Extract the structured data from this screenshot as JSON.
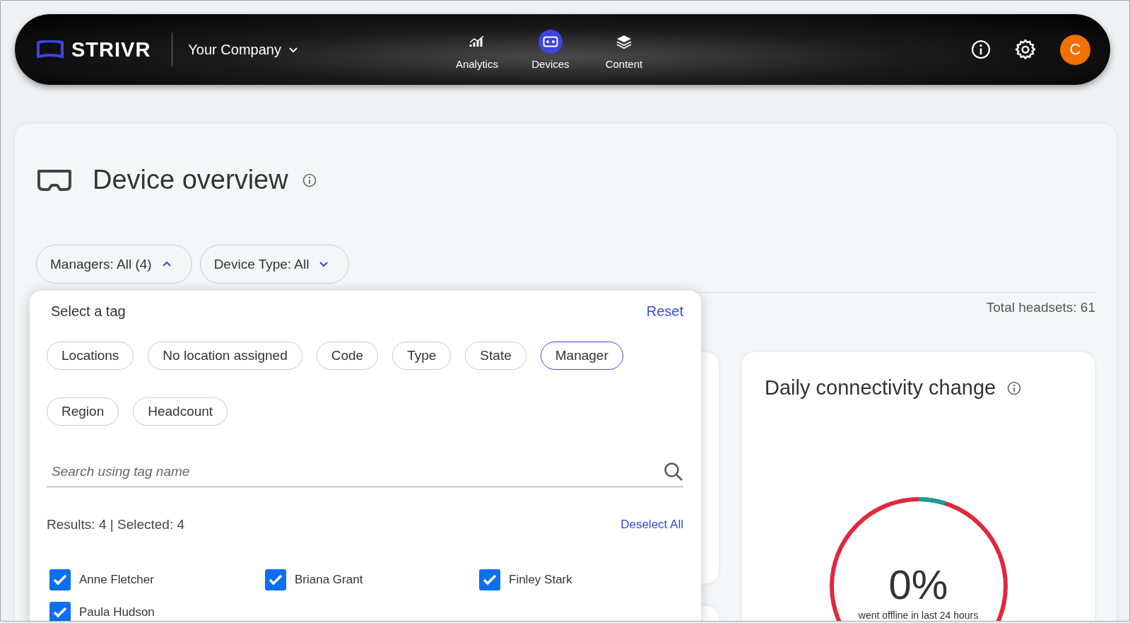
{
  "navbar": {
    "logo": "STRIVR",
    "company": "Your Company",
    "nav_items": [
      {
        "label": "Analytics",
        "kind": "analytics",
        "selected": false
      },
      {
        "label": "Devices",
        "kind": "devices",
        "selected": true
      },
      {
        "label": "Content",
        "kind": "content",
        "selected": false
      }
    ],
    "avatar": "C"
  },
  "page": {
    "title": "Device overview",
    "filters": [
      {
        "label": "Managers: All (4)",
        "expanded": true
      },
      {
        "label": "Device Type: All",
        "expanded": false
      }
    ],
    "total": "Total headsets: 61"
  },
  "tag_popup": {
    "title": "Select a tag",
    "reset": "Reset",
    "tags": [
      {
        "label": "Locations",
        "selected": false
      },
      {
        "label": "No location assigned",
        "selected": false
      },
      {
        "label": "Code",
        "selected": false
      },
      {
        "label": "Type",
        "selected": false
      },
      {
        "label": "State",
        "selected": false
      },
      {
        "label": "Manager",
        "selected": true
      },
      {
        "label": "Region",
        "selected": false
      },
      {
        "label": "Headcount",
        "selected": false
      }
    ],
    "search": {
      "placeholder": "Search using tag name"
    },
    "results": "Results: 4 | Selected: 4",
    "deselect": "Deselect All",
    "managers": [
      {
        "name": "Anne Fletcher",
        "checked": true
      },
      {
        "name": "Briana Grant",
        "checked": true
      },
      {
        "name": "Finley Stark",
        "checked": true
      },
      {
        "name": "Paula Hudson",
        "checked": true
      }
    ]
  },
  "connectivity_card": {
    "title": "Daily connectivity change",
    "value": "0%",
    "caption": "went offline in last 24 hours"
  }
}
